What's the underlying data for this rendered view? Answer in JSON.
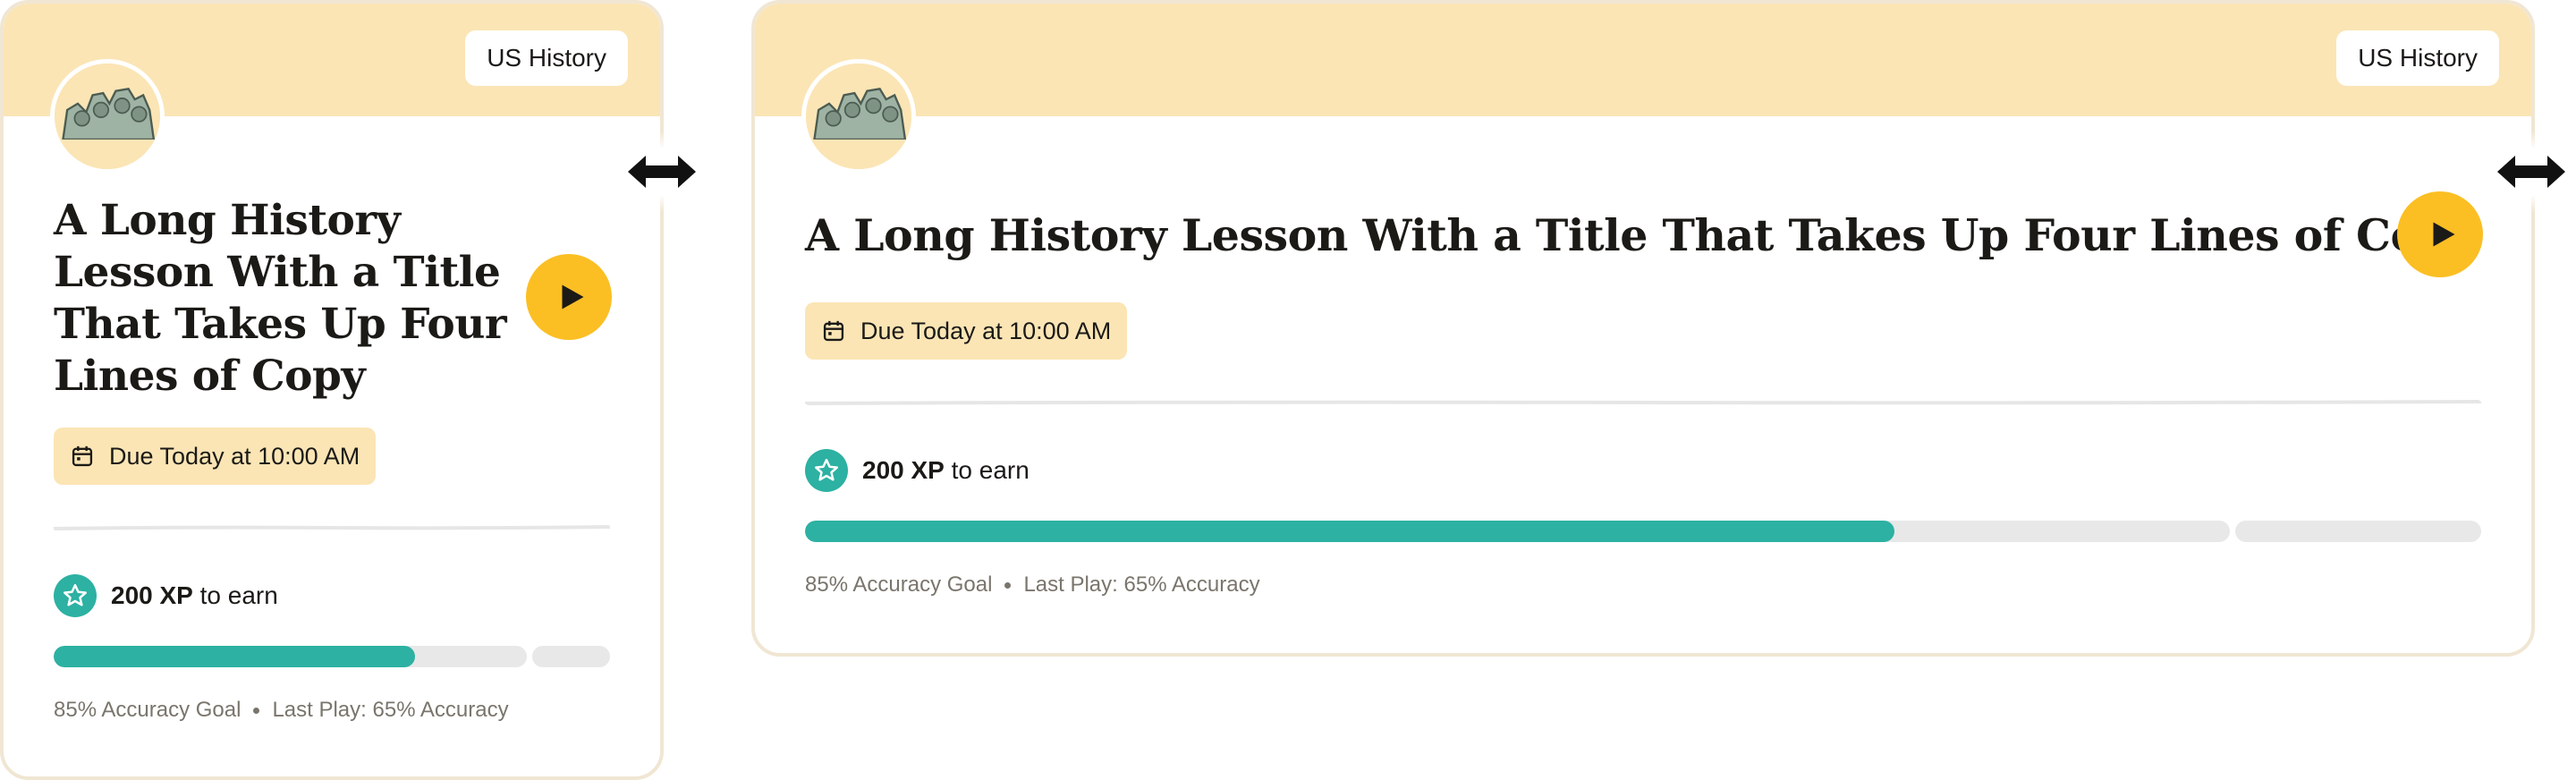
{
  "cards": [
    {
      "subject": "US History",
      "title": "A Long History Lesson With a Title That Takes Up Four Lines of Copy",
      "due": "Due Today at 10:00 AM",
      "xp_value": "200 XP",
      "xp_suffix": "to earn",
      "accuracy_goal_label": "85% Accuracy Goal",
      "last_play_label": "Last Play: 65% Accuracy",
      "progress_percent": 65,
      "goal_percent": 85
    },
    {
      "subject": "US History",
      "title": "A Long History Lesson With a Title That Takes Up Four Lines of Copy",
      "due": "Due Today at 10:00 AM",
      "xp_value": "200 XP",
      "xp_suffix": "to earn",
      "accuracy_goal_label": "85% Accuracy Goal",
      "last_play_label": "Last Play: 65% Accuracy",
      "progress_percent": 65,
      "goal_percent": 85
    }
  ],
  "icons": {
    "avatar": "mount-rushmore-icon",
    "play": "play-icon",
    "calendar": "calendar-icon",
    "xp": "star-icon",
    "resize": "resize-horizontal-icon"
  },
  "colors": {
    "band": "#fbe5b5",
    "accent_play": "#fbbf24",
    "progress": "#2cb1a2",
    "border": "#f0e6d3"
  }
}
